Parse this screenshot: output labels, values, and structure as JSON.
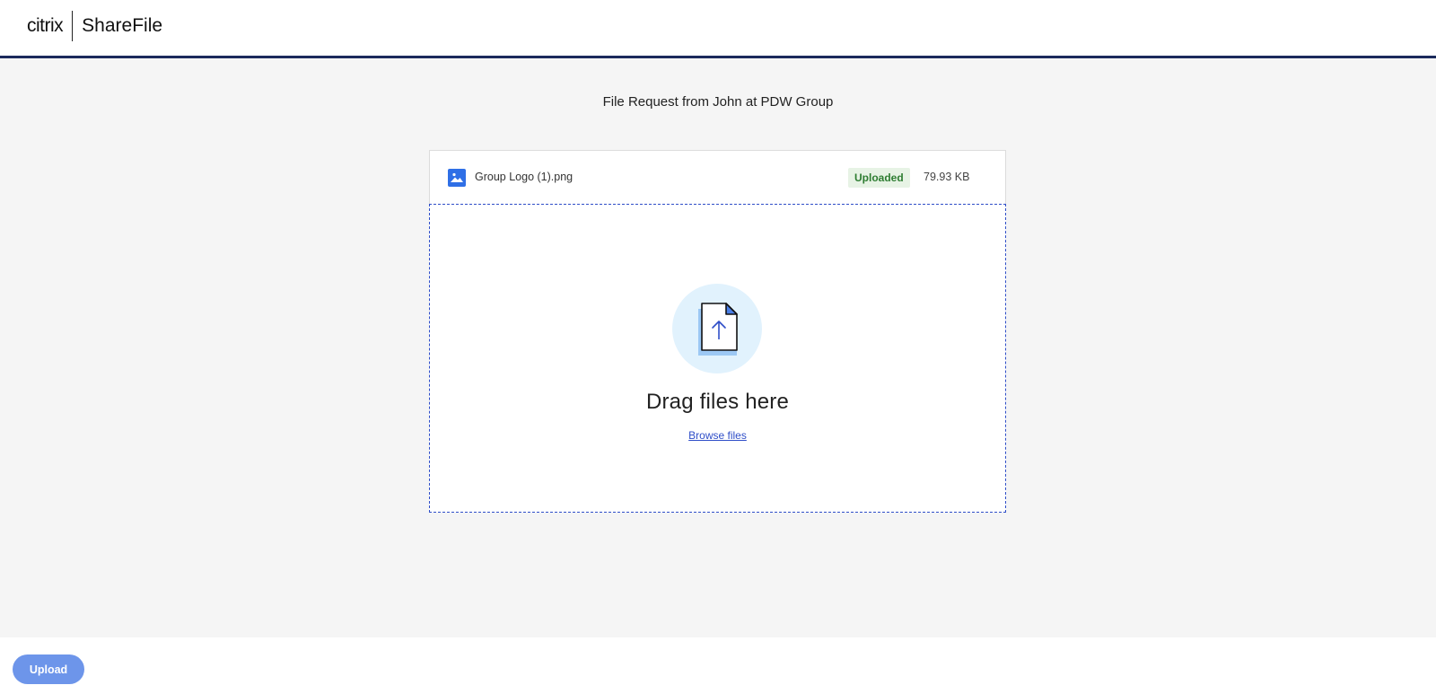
{
  "header": {
    "brand_company": "citrix",
    "brand_product": "ShareFile",
    "accent_color": "#1b2a5c"
  },
  "main": {
    "title": "File Request from John at PDW Group",
    "files": [
      {
        "name": "Group Logo (1).png",
        "status": "Uploaded",
        "size": "79.93 KB",
        "icon": "image-file-icon"
      }
    ],
    "dropzone": {
      "heading": "Drag files here",
      "browse_label": "Browse files",
      "icon": "file-upload-icon"
    }
  },
  "footer": {
    "upload_label": "Upload",
    "upload_color": "#6d95ea"
  }
}
